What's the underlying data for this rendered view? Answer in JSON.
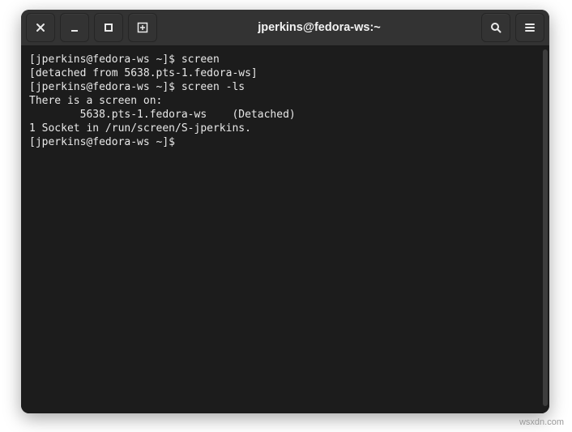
{
  "window": {
    "title": "jperkins@fedora-ws:~"
  },
  "terminal": {
    "lines": [
      {
        "prompt": "[jperkins@fedora-ws ~]$ ",
        "cmd": "screen"
      },
      {
        "text": "[detached from 5638.pts-1.fedora-ws]"
      },
      {
        "prompt": "[jperkins@fedora-ws ~]$ ",
        "cmd": "screen -ls"
      },
      {
        "text": "There is a screen on:"
      },
      {
        "text": "        5638.pts-1.fedora-ws    (Detached)"
      },
      {
        "text": "1 Socket in /run/screen/S-jperkins."
      },
      {
        "prompt": "[jperkins@fedora-ws ~]$ ",
        "cmd": ""
      }
    ]
  },
  "icons": {
    "close": "close-icon",
    "minimize": "minimize-icon",
    "maximize": "maximize-icon",
    "newtab": "new-tab-icon",
    "search": "search-icon",
    "menu": "hamburger-icon"
  },
  "watermark": "wsxdn.com"
}
